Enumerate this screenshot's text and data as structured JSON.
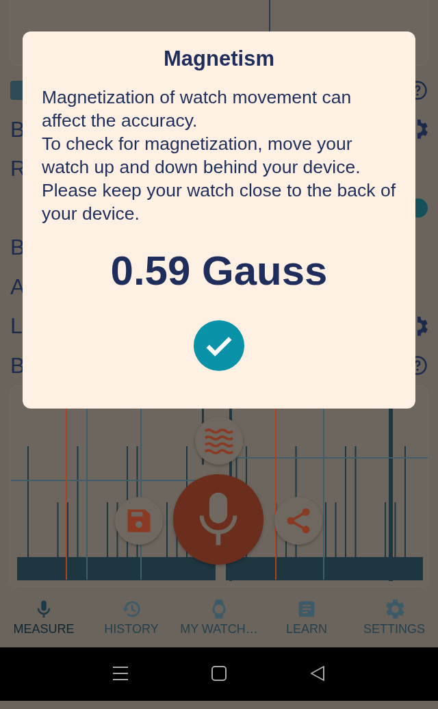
{
  "background_rows": [
    {
      "kind": "chip",
      "trailing": {
        "kind": "help"
      }
    },
    {
      "kind": "text",
      "label": "B",
      "trailing": {
        "kind": "gear"
      }
    },
    {
      "kind": "text",
      "label": "R"
    },
    {
      "kind": "empty",
      "trailing": {
        "kind": "toggle"
      }
    },
    {
      "kind": "text",
      "label": "B"
    },
    {
      "kind": "text",
      "label": "A"
    },
    {
      "kind": "text",
      "label": "L",
      "trailing": {
        "kind": "gear"
      }
    },
    {
      "kind": "text",
      "label": "B",
      "trailing": {
        "kind": "help"
      }
    }
  ],
  "dialog": {
    "title": "Magnetism",
    "message": "Magnetization of watch movement can affect the accuracy.\n To check for magnetization, move your watch up and down behind your device. Please keep your watch close to the back of your device.",
    "reading": "0.59 Gauss"
  },
  "nav": [
    {
      "label": "MEASURE",
      "kind": "mic",
      "selected": true
    },
    {
      "label": "HISTORY",
      "kind": "history",
      "selected": false
    },
    {
      "label": "MY WATCH…",
      "kind": "watch",
      "selected": false
    },
    {
      "label": "LEARN",
      "kind": "article",
      "selected": false
    },
    {
      "label": "SETTINGS",
      "kind": "gear",
      "selected": false
    }
  ]
}
